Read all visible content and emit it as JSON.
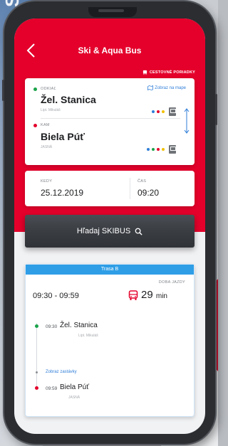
{
  "background": {
    "left_text": "SK"
  },
  "app": {
    "title": "Ski & Aqua Bus",
    "timetables_link": "CESTOVNÉ PORIADKY"
  },
  "route": {
    "from_label": "ODKIAĽ",
    "from_stop": "Žel. Stanica",
    "from_sub": "Lipt. Mikuláš",
    "map_link": "Zobraz na mape",
    "to_label": "KAM",
    "to_stop": "Biela Púť",
    "to_sub": "JASNÁ",
    "line_colors_from": [
      "#2f7ed8",
      "#e4002b",
      "#f2c100"
    ],
    "line_colors_to": [
      "#2f7ed8",
      "#1aa34a",
      "#e4002b",
      "#f2c100"
    ]
  },
  "datetime": {
    "date_label": "KEDY",
    "date_value": "25.12.2019",
    "time_label": "ČAS",
    "time_value": "09:20"
  },
  "search": {
    "button_label": "Hľadaj SKIBUS"
  },
  "result": {
    "header": "Trasa B",
    "time_range": "09:30 - 09:59",
    "duration_label": "DOBA JAZDY",
    "duration_value": "29",
    "duration_unit": "min",
    "steps": [
      {
        "time": "09:30",
        "stop": "Žel. Stanica",
        "sub": "Lipt. Mikuláš"
      },
      {
        "time": "09:59",
        "stop": "Biela Púť",
        "sub": "JASNÁ"
      }
    ],
    "show_stops": "Zobraz zastávky"
  },
  "colors": {
    "brand_red": "#e4002b",
    "accent_blue": "#2f9ee6",
    "link_blue": "#2f7ed8"
  }
}
